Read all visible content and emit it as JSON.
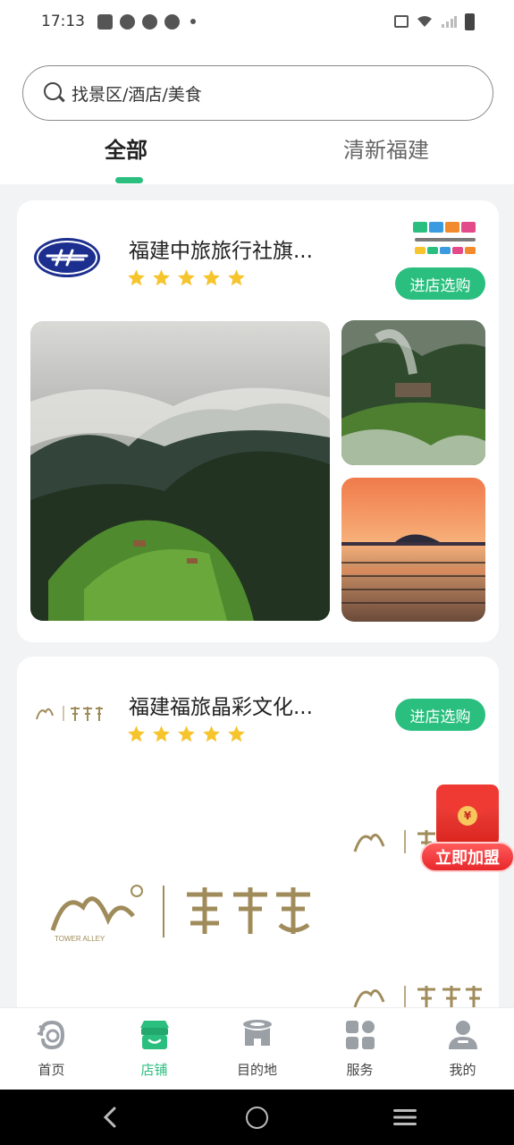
{
  "status_bar": {
    "time": "17:13",
    "left_icons": [
      "notification-icon",
      "app-icon",
      "app-icon",
      "app-icon",
      "dot-icon"
    ],
    "right_icons": [
      "vibrate-icon",
      "wifi-icon",
      "signal-icon",
      "battery-icon"
    ]
  },
  "search": {
    "placeholder": "找景区/酒店/美食"
  },
  "tabs": [
    {
      "label": "全部",
      "active": true
    },
    {
      "label": "清新福建",
      "active": false
    }
  ],
  "stores": [
    {
      "name": "福建中旅旅行社旗...",
      "rating": 5,
      "logo": "cts-logo",
      "badge": "清新福建-badge",
      "button": "进店选购",
      "photos": [
        "misty-mountain-photo",
        "mountain-village-photo",
        "sunset-sea-photo"
      ]
    },
    {
      "name": "福建福旅晶彩文化...",
      "rating": 5,
      "logo": "tower-alley-logo",
      "button": "进店选购",
      "logo_caption": "TOWER ALLEY"
    }
  ],
  "join_float": {
    "label": "立即加盟",
    "coin": "¥"
  },
  "bottom_nav": [
    {
      "label": "首页",
      "icon": "home-icon",
      "active": false
    },
    {
      "label": "店铺",
      "icon": "store-icon",
      "active": true
    },
    {
      "label": "目的地",
      "icon": "destination-icon",
      "active": false
    },
    {
      "label": "服务",
      "icon": "service-icon",
      "active": false
    },
    {
      "label": "我的",
      "icon": "profile-icon",
      "active": false
    }
  ],
  "colors": {
    "accent": "#2bbf7f",
    "background": "#f2f3f5",
    "join_red": "#e8272b"
  }
}
